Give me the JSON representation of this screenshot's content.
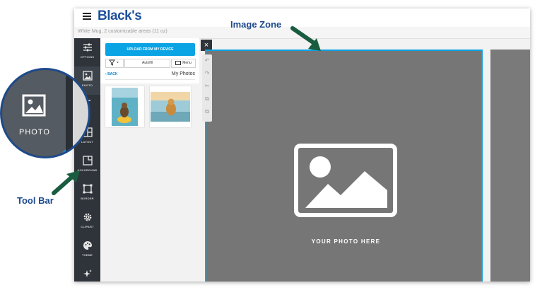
{
  "annotations": {
    "image_zone": "Image Zone",
    "tool_bar": "Tool Bar"
  },
  "colors": {
    "brand": "#1e4f9c",
    "accent": "#0aa3e4",
    "toolbar_bg": "#2f343a",
    "annotation": "#1e4a8c",
    "arrow": "#1a5c3f"
  },
  "header": {
    "logo": "Black's",
    "product_info": "White Mug, 2 customizable areas (11 oz)"
  },
  "toolbar": {
    "items": [
      {
        "label": "OPTIONS",
        "icon": "sliders-icon"
      },
      {
        "label": "PHOTO",
        "icon": "image-icon"
      },
      {
        "label": "",
        "icon": "text-icon"
      },
      {
        "label": "LAYOUT",
        "icon": "layout-icon"
      },
      {
        "label": "ACKGROUND",
        "icon": "background-icon"
      },
      {
        "label": "BORDER",
        "icon": "border-icon"
      },
      {
        "label": "CLIPART",
        "icon": "gear-icon"
      },
      {
        "label": "THEME",
        "icon": "palette-icon"
      },
      {
        "label": "",
        "icon": "sparkle-icon"
      }
    ]
  },
  "zoom": {
    "label": "PHOTO"
  },
  "panel": {
    "upload_button": "UPLOAD FROM MY DEVICE",
    "autofill": "Autofill",
    "menu": "Menu",
    "back": "BACK",
    "title": "My Photos"
  },
  "canvas": {
    "placeholder_caption": "YOUR PHOTO HERE"
  }
}
